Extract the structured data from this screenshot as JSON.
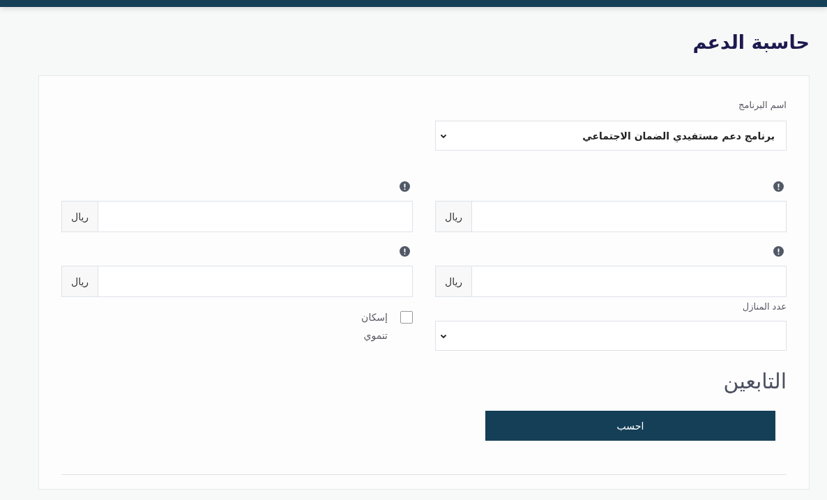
{
  "page_title": "حاسبة الدعم",
  "program": {
    "label": "اسم البرنامج",
    "value": "برنامج دعم مستفيدي الضمان الاجتماعي"
  },
  "money_fields": [
    {
      "unit": "ريال"
    },
    {
      "unit": "ريال"
    },
    {
      "unit": "ريال"
    },
    {
      "unit": "ريال"
    }
  ],
  "houses": {
    "label": "عدد المنازل"
  },
  "housing_option": {
    "label": "إسكان تنموي",
    "checked": false
  },
  "dependents_heading": "التابعين",
  "calculate_button": "احسب"
}
